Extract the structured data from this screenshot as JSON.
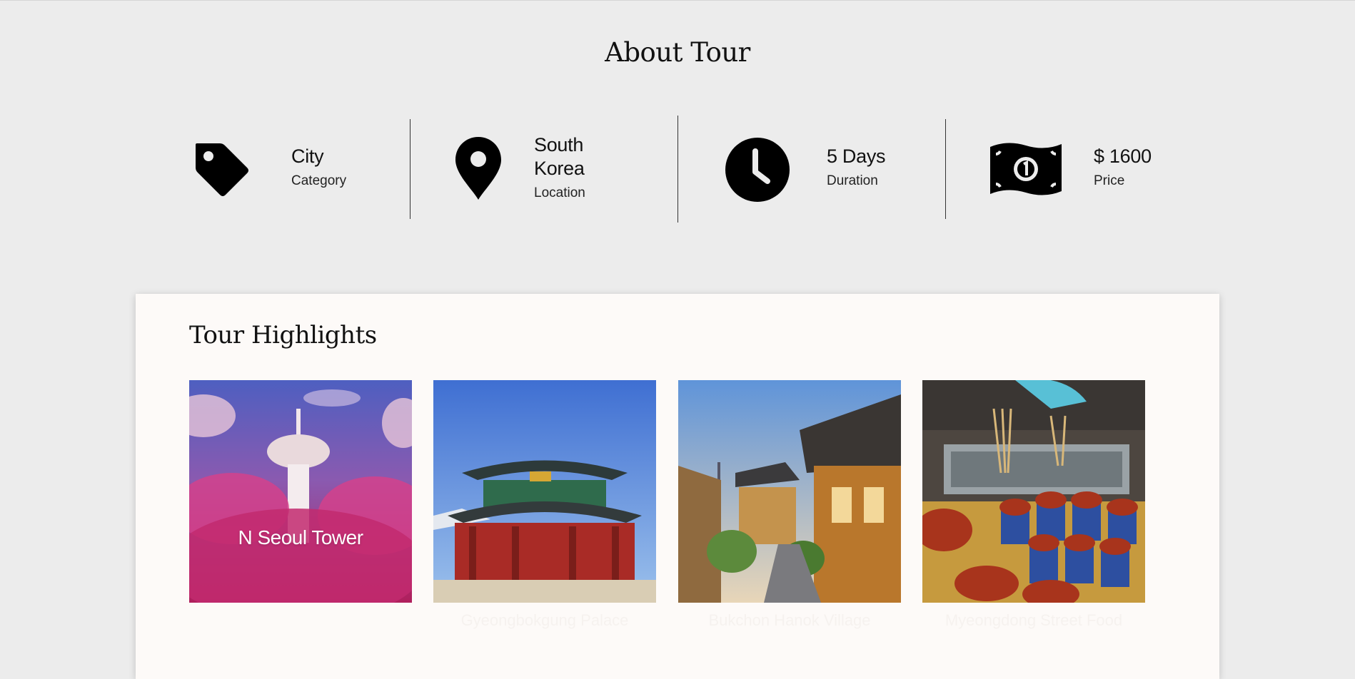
{
  "about": {
    "title": "About Tour",
    "items": [
      {
        "value": "City",
        "label": "Category",
        "icon": "tag-icon"
      },
      {
        "value": "South Korea",
        "label": "Location",
        "icon": "map-pin-icon"
      },
      {
        "value": "5 Days",
        "label": "Duration",
        "icon": "clock-icon"
      },
      {
        "value": "$ 1600",
        "label": "Price",
        "icon": "money-bill-icon"
      }
    ]
  },
  "highlights": {
    "title": "Tour Highlights",
    "tiles": [
      {
        "caption": "N Seoul Tower"
      },
      {
        "caption": "Gyeongbokgung Palace"
      },
      {
        "caption": "Bukchon Hanok Village"
      },
      {
        "caption": "Myeongdong Street Food"
      }
    ]
  },
  "colors": {
    "page_background": "#ececec",
    "card_background": "#fdfaf8",
    "text": "#111111"
  }
}
